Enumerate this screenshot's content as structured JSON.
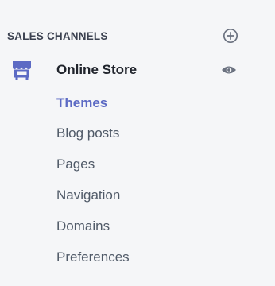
{
  "sidebar": {
    "section_title": "SALES CHANNELS",
    "channel": {
      "label": "Online Store",
      "icon": "store-icon",
      "visibility_icon": "eye-icon"
    },
    "add_icon": "plus-circle-icon",
    "items": [
      {
        "label": "Themes",
        "active": true
      },
      {
        "label": "Blog posts",
        "active": false
      },
      {
        "label": "Pages",
        "active": false
      },
      {
        "label": "Navigation",
        "active": false
      },
      {
        "label": "Domains",
        "active": false
      },
      {
        "label": "Preferences",
        "active": false
      }
    ]
  },
  "colors": {
    "background": "#f5f6f8",
    "accent": "#5c6ac4",
    "icon": "#6b7280",
    "text": "#505a68",
    "heading": "#3b4150"
  }
}
